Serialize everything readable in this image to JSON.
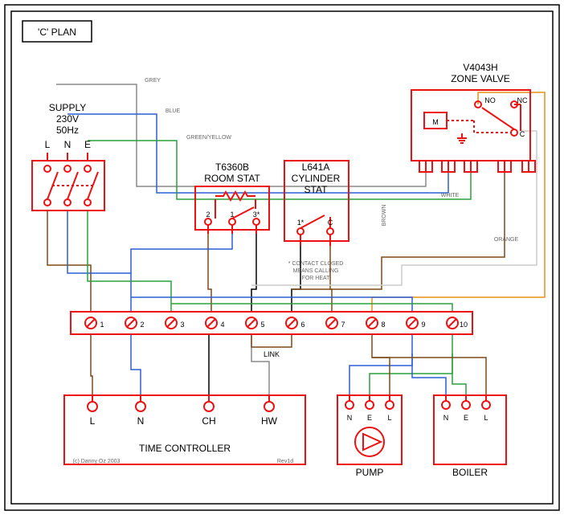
{
  "title": "'C' PLAN",
  "supply": {
    "label": "SUPPLY",
    "voltage": "230V",
    "freq": "50Hz",
    "terminals": [
      "L",
      "N",
      "E"
    ]
  },
  "roomstat": {
    "model": "T6360B",
    "label": "ROOM STAT",
    "terminals": [
      "2",
      "1",
      "3*"
    ]
  },
  "cylstat": {
    "model": "L641A",
    "label1": "CYLINDER",
    "label2": "STAT",
    "terminals": [
      "1*",
      "C"
    ],
    "note1": "* CONTACT CLOSED",
    "note2": "MEANS CALLING",
    "note3": "FOR HEAT"
  },
  "zonevalve": {
    "model": "V4043H",
    "label": "ZONE VALVE",
    "motor": "M",
    "no": "NO",
    "nc": "NC",
    "c": "C"
  },
  "terminals": {
    "numbers": [
      "1",
      "2",
      "3",
      "4",
      "5",
      "6",
      "7",
      "8",
      "9",
      "10"
    ],
    "link": "LINK"
  },
  "timectrl": {
    "label": "TIME CONTROLLER",
    "terminals": [
      "L",
      "N",
      "CH",
      "HW"
    ],
    "rev": "Rev1d",
    "copy": "(c) Danny Oz 2003"
  },
  "pump": {
    "label": "PUMP",
    "terminals": [
      "N",
      "E",
      "L"
    ]
  },
  "boiler": {
    "label": "BOILER",
    "terminals": [
      "N",
      "E",
      "L"
    ]
  },
  "wirelabels": {
    "grey": "GREY",
    "blue": "BLUE",
    "green": "GREEN/YELLOW",
    "brown": "BROWN",
    "white": "WHITE",
    "orange": "ORANGE"
  }
}
